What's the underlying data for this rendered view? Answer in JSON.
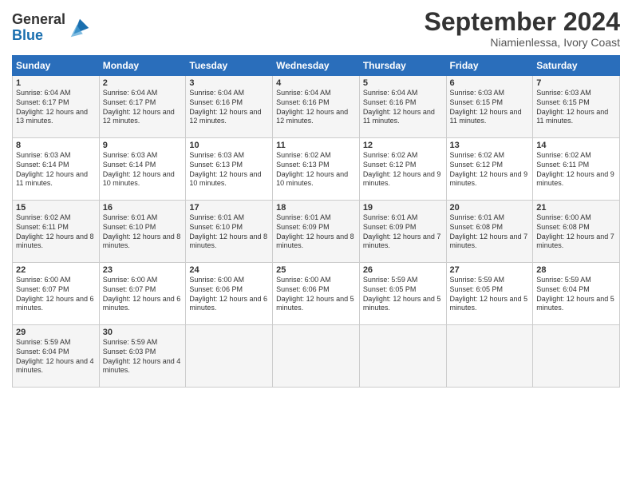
{
  "header": {
    "logo_general": "General",
    "logo_blue": "Blue",
    "month_title": "September 2024",
    "location": "Niamienlessa, Ivory Coast"
  },
  "days_of_week": [
    "Sunday",
    "Monday",
    "Tuesday",
    "Wednesday",
    "Thursday",
    "Friday",
    "Saturday"
  ],
  "weeks": [
    [
      {
        "day": "1",
        "sunrise": "Sunrise: 6:04 AM",
        "sunset": "Sunset: 6:17 PM",
        "daylight": "Daylight: 12 hours and 13 minutes."
      },
      {
        "day": "2",
        "sunrise": "Sunrise: 6:04 AM",
        "sunset": "Sunset: 6:17 PM",
        "daylight": "Daylight: 12 hours and 12 minutes."
      },
      {
        "day": "3",
        "sunrise": "Sunrise: 6:04 AM",
        "sunset": "Sunset: 6:16 PM",
        "daylight": "Daylight: 12 hours and 12 minutes."
      },
      {
        "day": "4",
        "sunrise": "Sunrise: 6:04 AM",
        "sunset": "Sunset: 6:16 PM",
        "daylight": "Daylight: 12 hours and 12 minutes."
      },
      {
        "day": "5",
        "sunrise": "Sunrise: 6:04 AM",
        "sunset": "Sunset: 6:16 PM",
        "daylight": "Daylight: 12 hours and 11 minutes."
      },
      {
        "day": "6",
        "sunrise": "Sunrise: 6:03 AM",
        "sunset": "Sunset: 6:15 PM",
        "daylight": "Daylight: 12 hours and 11 minutes."
      },
      {
        "day": "7",
        "sunrise": "Sunrise: 6:03 AM",
        "sunset": "Sunset: 6:15 PM",
        "daylight": "Daylight: 12 hours and 11 minutes."
      }
    ],
    [
      {
        "day": "8",
        "sunrise": "Sunrise: 6:03 AM",
        "sunset": "Sunset: 6:14 PM",
        "daylight": "Daylight: 12 hours and 11 minutes."
      },
      {
        "day": "9",
        "sunrise": "Sunrise: 6:03 AM",
        "sunset": "Sunset: 6:14 PM",
        "daylight": "Daylight: 12 hours and 10 minutes."
      },
      {
        "day": "10",
        "sunrise": "Sunrise: 6:03 AM",
        "sunset": "Sunset: 6:13 PM",
        "daylight": "Daylight: 12 hours and 10 minutes."
      },
      {
        "day": "11",
        "sunrise": "Sunrise: 6:02 AM",
        "sunset": "Sunset: 6:13 PM",
        "daylight": "Daylight: 12 hours and 10 minutes."
      },
      {
        "day": "12",
        "sunrise": "Sunrise: 6:02 AM",
        "sunset": "Sunset: 6:12 PM",
        "daylight": "Daylight: 12 hours and 9 minutes."
      },
      {
        "day": "13",
        "sunrise": "Sunrise: 6:02 AM",
        "sunset": "Sunset: 6:12 PM",
        "daylight": "Daylight: 12 hours and 9 minutes."
      },
      {
        "day": "14",
        "sunrise": "Sunrise: 6:02 AM",
        "sunset": "Sunset: 6:11 PM",
        "daylight": "Daylight: 12 hours and 9 minutes."
      }
    ],
    [
      {
        "day": "15",
        "sunrise": "Sunrise: 6:02 AM",
        "sunset": "Sunset: 6:11 PM",
        "daylight": "Daylight: 12 hours and 8 minutes."
      },
      {
        "day": "16",
        "sunrise": "Sunrise: 6:01 AM",
        "sunset": "Sunset: 6:10 PM",
        "daylight": "Daylight: 12 hours and 8 minutes."
      },
      {
        "day": "17",
        "sunrise": "Sunrise: 6:01 AM",
        "sunset": "Sunset: 6:10 PM",
        "daylight": "Daylight: 12 hours and 8 minutes."
      },
      {
        "day": "18",
        "sunrise": "Sunrise: 6:01 AM",
        "sunset": "Sunset: 6:09 PM",
        "daylight": "Daylight: 12 hours and 8 minutes."
      },
      {
        "day": "19",
        "sunrise": "Sunrise: 6:01 AM",
        "sunset": "Sunset: 6:09 PM",
        "daylight": "Daylight: 12 hours and 7 minutes."
      },
      {
        "day": "20",
        "sunrise": "Sunrise: 6:01 AM",
        "sunset": "Sunset: 6:08 PM",
        "daylight": "Daylight: 12 hours and 7 minutes."
      },
      {
        "day": "21",
        "sunrise": "Sunrise: 6:00 AM",
        "sunset": "Sunset: 6:08 PM",
        "daylight": "Daylight: 12 hours and 7 minutes."
      }
    ],
    [
      {
        "day": "22",
        "sunrise": "Sunrise: 6:00 AM",
        "sunset": "Sunset: 6:07 PM",
        "daylight": "Daylight: 12 hours and 6 minutes."
      },
      {
        "day": "23",
        "sunrise": "Sunrise: 6:00 AM",
        "sunset": "Sunset: 6:07 PM",
        "daylight": "Daylight: 12 hours and 6 minutes."
      },
      {
        "day": "24",
        "sunrise": "Sunrise: 6:00 AM",
        "sunset": "Sunset: 6:06 PM",
        "daylight": "Daylight: 12 hours and 6 minutes."
      },
      {
        "day": "25",
        "sunrise": "Sunrise: 6:00 AM",
        "sunset": "Sunset: 6:06 PM",
        "daylight": "Daylight: 12 hours and 5 minutes."
      },
      {
        "day": "26",
        "sunrise": "Sunrise: 5:59 AM",
        "sunset": "Sunset: 6:05 PM",
        "daylight": "Daylight: 12 hours and 5 minutes."
      },
      {
        "day": "27",
        "sunrise": "Sunrise: 5:59 AM",
        "sunset": "Sunset: 6:05 PM",
        "daylight": "Daylight: 12 hours and 5 minutes."
      },
      {
        "day": "28",
        "sunrise": "Sunrise: 5:59 AM",
        "sunset": "Sunset: 6:04 PM",
        "daylight": "Daylight: 12 hours and 5 minutes."
      }
    ],
    [
      {
        "day": "29",
        "sunrise": "Sunrise: 5:59 AM",
        "sunset": "Sunset: 6:04 PM",
        "daylight": "Daylight: 12 hours and 4 minutes."
      },
      {
        "day": "30",
        "sunrise": "Sunrise: 5:59 AM",
        "sunset": "Sunset: 6:03 PM",
        "daylight": "Daylight: 12 hours and 4 minutes."
      },
      {
        "day": "",
        "sunrise": "",
        "sunset": "",
        "daylight": ""
      },
      {
        "day": "",
        "sunrise": "",
        "sunset": "",
        "daylight": ""
      },
      {
        "day": "",
        "sunrise": "",
        "sunset": "",
        "daylight": ""
      },
      {
        "day": "",
        "sunrise": "",
        "sunset": "",
        "daylight": ""
      },
      {
        "day": "",
        "sunrise": "",
        "sunset": "",
        "daylight": ""
      }
    ]
  ]
}
